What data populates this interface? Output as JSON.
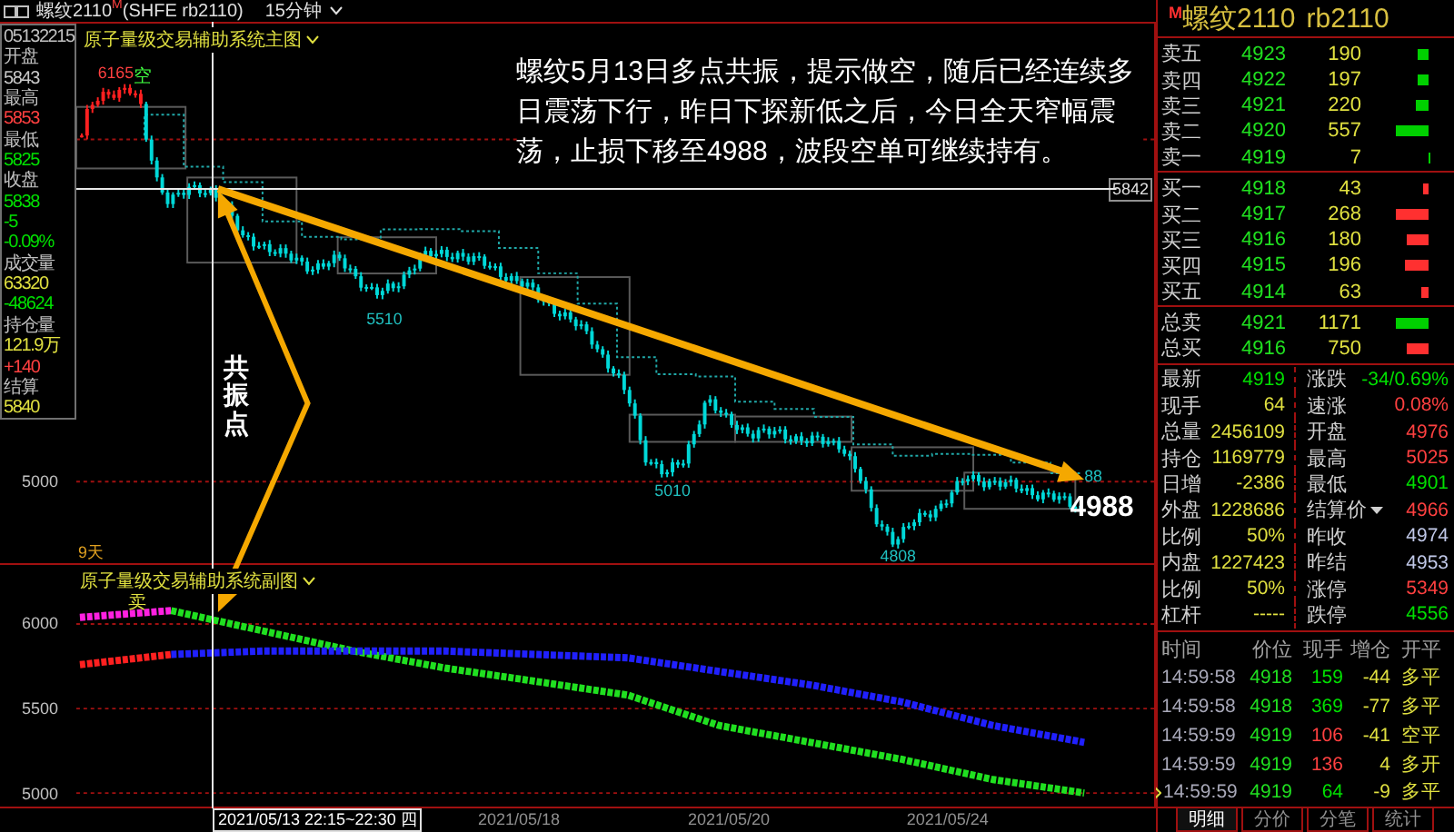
{
  "header": {
    "title": "螺纹2110$^{M}$(SHFE rb2110)",
    "period": "15分钟"
  },
  "info_panel": [
    {
      "text": "05132215",
      "color": "#c0c0c0"
    },
    {
      "text": "开盘",
      "color": "#c0c0c0"
    },
    {
      "text": "5843",
      "color": "#c8c8c8"
    },
    {
      "text": "最高",
      "color": "#c0c0c0"
    },
    {
      "text": "5853",
      "color": "#ff4040"
    },
    {
      "text": "最低",
      "color": "#c0c0c0"
    },
    {
      "text": "5825",
      "color": "#00e000"
    },
    {
      "text": "收盘",
      "color": "#c0c0c0"
    },
    {
      "text": "5838",
      "color": "#00e000"
    },
    {
      "text": "-5",
      "color": "#00e000"
    },
    {
      "text": "-0.09%",
      "color": "#00e000"
    },
    {
      "text": "成交量",
      "color": "#c0c0c0"
    },
    {
      "text": "63320",
      "color": "#e0e040"
    },
    {
      "text": "-48624",
      "color": "#00e000"
    },
    {
      "text": "持仓量",
      "color": "#c0c0c0"
    },
    {
      "text": "121.9万",
      "color": "#e0e040"
    },
    {
      "text": "+140",
      "color": "#ff4040"
    },
    {
      "text": "结算",
      "color": "#c0c0c0"
    },
    {
      "text": "5840",
      "color": "#e0e040"
    }
  ],
  "main_chart": {
    "title": "原子量级交易辅助系统主图",
    "y_label": "5000",
    "price_tag": "5842",
    "signal": "空",
    "period_count": "9天",
    "labels": [
      {
        "text": "6165",
        "color": "#ff4040"
      },
      {
        "text": "5510",
        "color": "#20c0c0"
      },
      {
        "text": "5010",
        "color": "#20c0c0"
      },
      {
        "text": "4808",
        "color": "#20c0c0"
      },
      {
        "text": "88",
        "color": "#20c0c0"
      }
    ],
    "annotation": "螺纹5月13日多点共振，提示做空，随后已经连续多日震荡下行，昨日下探新低之后，今日全天窄幅震荡，止损下移至4988，波段空单可继续持有。",
    "target": "4988",
    "resonance_label": "共振点"
  },
  "sub_chart": {
    "title": "原子量级交易辅助系统副图",
    "signal": "卖",
    "chart_data": {
      "type": "line",
      "ylim": [
        4920,
        6350
      ],
      "yticks": [
        5000,
        5500,
        6000
      ],
      "grid": true,
      "series": [
        {
          "color": "#ff20e0",
          "line_style": "dotted",
          "values": [
            6040,
            6080,
            null,
            null,
            null,
            null,
            null,
            null,
            null,
            null,
            null,
            null
          ]
        },
        {
          "color": "#20e020",
          "line_style": "dotted",
          "values": [
            null,
            6080,
            5960,
            5840,
            5740,
            5660,
            5580,
            5400,
            5300,
            5200,
            5080,
            5000
          ]
        },
        {
          "color": "#ff2020",
          "line_style": "dotted",
          "values": [
            5760,
            5820,
            null,
            null,
            null,
            null,
            null,
            null,
            null,
            null,
            null,
            null
          ]
        },
        {
          "color": "#2020ff",
          "line_style": "dotted",
          "values": [
            null,
            5820,
            5840,
            5840,
            5840,
            5820,
            5800,
            5720,
            5640,
            5540,
            5400,
            5300
          ]
        }
      ]
    }
  },
  "time_axis": {
    "cursor": "2021/05/13 22:15~22:30 四",
    "dates": [
      "2021/05/18",
      "2021/05/20",
      "2021/05/24"
    ]
  },
  "quote": {
    "flag": "M",
    "name": "螺纹2110",
    "code": "rb2110",
    "asks": [
      {
        "label": "卖五",
        "price": "4923",
        "volume": "190"
      },
      {
        "label": "卖四",
        "price": "4922",
        "volume": "197"
      },
      {
        "label": "卖三",
        "price": "4921",
        "volume": "220"
      },
      {
        "label": "卖二",
        "price": "4920",
        "volume": "557"
      },
      {
        "label": "卖一",
        "price": "4919",
        "volume": "7"
      }
    ],
    "bids": [
      {
        "label": "买一",
        "price": "4918",
        "volume": "43"
      },
      {
        "label": "买二",
        "price": "4917",
        "volume": "268"
      },
      {
        "label": "买三",
        "price": "4916",
        "volume": "180"
      },
      {
        "label": "买四",
        "price": "4915",
        "volume": "196"
      },
      {
        "label": "买五",
        "price": "4914",
        "volume": "63"
      }
    ],
    "totals": [
      {
        "label": "总卖",
        "price": "4921",
        "volume": "1171",
        "kind": "sell"
      },
      {
        "label": "总买",
        "price": "4916",
        "volume": "750",
        "kind": "buy"
      }
    ],
    "stats": [
      {
        "label": "最新",
        "value": "4919",
        "color": "#00e000",
        "dropdown": false
      },
      {
        "label": "涨跌",
        "value": "-34/0.69%",
        "color": "#00e000",
        "dropdown": false
      },
      {
        "label": "现手",
        "value": "64",
        "color": "#e0e040",
        "dropdown": false
      },
      {
        "label": "速涨",
        "value": "0.08%",
        "color": "#ff4040",
        "dropdown": false
      },
      {
        "label": "总量",
        "value": "2456109",
        "color": "#e0e040",
        "dropdown": false
      },
      {
        "label": "开盘",
        "value": "4976",
        "color": "#ff4040",
        "dropdown": false
      },
      {
        "label": "持仓",
        "value": "1169779",
        "color": "#e0e040",
        "dropdown": false
      },
      {
        "label": "最高",
        "value": "5025",
        "color": "#ff4040",
        "dropdown": false
      },
      {
        "label": "日增",
        "value": "-2386",
        "color": "#e0e040",
        "dropdown": false
      },
      {
        "label": "最低",
        "value": "4901",
        "color": "#00e000",
        "dropdown": false
      },
      {
        "label": "外盘",
        "value": "1228686",
        "color": "#e0e040",
        "dropdown": false
      },
      {
        "label": "结算价",
        "value": "4966",
        "color": "#ff4040",
        "dropdown": true
      },
      {
        "label": "比例",
        "value": "50%",
        "color": "#e0e040",
        "dropdown": false
      },
      {
        "label": "昨收",
        "value": "4974",
        "color": "#c0c8e8",
        "dropdown": false
      },
      {
        "label": "内盘",
        "value": "1227423",
        "color": "#e0e040",
        "dropdown": false
      },
      {
        "label": "昨结",
        "value": "4953",
        "color": "#c0c8e8",
        "dropdown": false
      },
      {
        "label": "比例",
        "value": "50%",
        "color": "#e0e040",
        "dropdown": false
      },
      {
        "label": "涨停",
        "value": "5349",
        "color": "#ff4040",
        "dropdown": false
      },
      {
        "label": "杠杆",
        "value": "-----",
        "color": "#e0e040",
        "dropdown": false
      },
      {
        "label": "跌停",
        "value": "4556",
        "color": "#00e000",
        "dropdown": false
      }
    ],
    "trades": {
      "columns": [
        "时间",
        "价位",
        "现手",
        "增仓",
        "开平"
      ],
      "rows": [
        {
          "time": "14:59:58",
          "price": "4918",
          "volume": "159",
          "color": "#00e000",
          "change": "-44",
          "action": "多平",
          "selected": false
        },
        {
          "time": "14:59:58",
          "price": "4918",
          "volume": "369",
          "color": "#00e000",
          "change": "-77",
          "action": "多平",
          "selected": false
        },
        {
          "time": "14:59:59",
          "price": "4919",
          "volume": "106",
          "color": "#ff4040",
          "change": "-41",
          "action": "空平",
          "selected": false
        },
        {
          "time": "14:59:59",
          "price": "4919",
          "volume": "136",
          "color": "#ff4040",
          "change": "4",
          "action": "多开",
          "selected": false
        },
        {
          "time": "14:59:59",
          "price": "4919",
          "volume": "64",
          "color": "#00e000",
          "change": "-9",
          "action": "多平",
          "selected": true
        }
      ]
    },
    "tabs": [
      {
        "label": "明细",
        "selected": true
      },
      {
        "label": "分价",
        "selected": false
      },
      {
        "label": "分笔",
        "selected": false
      },
      {
        "label": "统计",
        "selected": false
      }
    ]
  }
}
